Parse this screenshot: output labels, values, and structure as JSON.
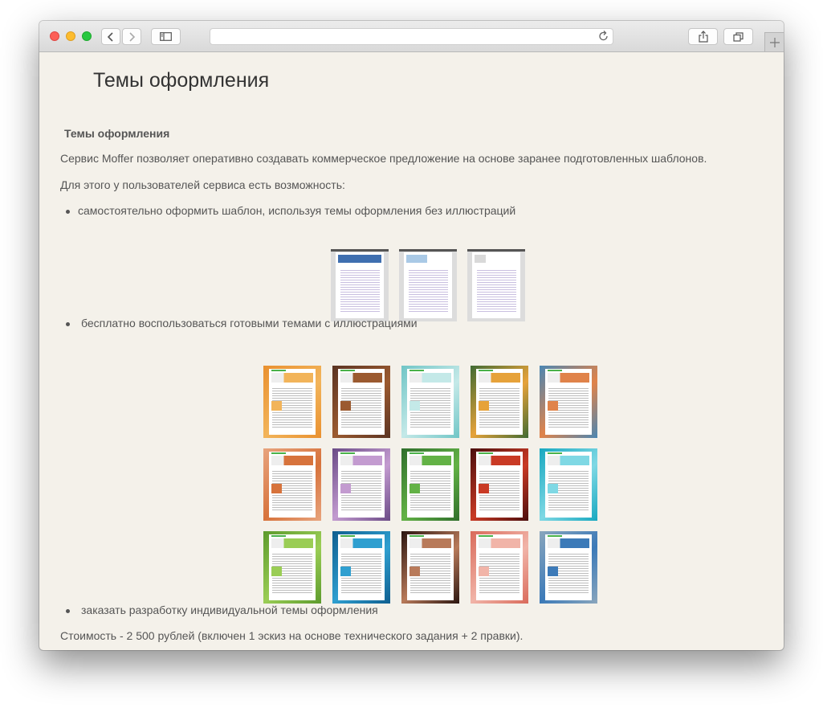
{
  "browser": {
    "url": "",
    "icons": {
      "back": "chevron-left-icon",
      "forward": "chevron-right-icon",
      "sidebar": "sidebar-icon",
      "reload": "reload-icon",
      "share": "share-icon",
      "tabs": "tabs-icon",
      "new_tab": "plus-icon"
    }
  },
  "page": {
    "title": "Темы оформления",
    "section_title": "Темы оформления",
    "intro": "Сервис Moffer позволяет оперативно создавать коммерческое предложение на основе заранее подготовленных шаблонов.",
    "possibility": "Для этого у пользователей сервиса есть возможность:",
    "bullets": [
      "самостоятельно оформить шаблон, используя темы оформления без иллюстраций",
      "бесплатно воспользоваться готовыми темами с иллюстрациями",
      "заказать разработку индивидуальной темы оформления"
    ],
    "price": "Стоимость - 2 500 рублей (включен 1 эскиз на основе технического задания + 2 правки)."
  },
  "plain_themes": [
    {
      "banner": "#3f6fb0"
    },
    {
      "banner": "#a9c9e6"
    },
    {
      "banner": "#d9d9d9"
    }
  ],
  "illustrated_themes": [
    {
      "bg": "#e9902f",
      "accent": "#f2b45a"
    },
    {
      "bg": "#5a3322",
      "accent": "#9b5a30"
    },
    {
      "bg": "#6fc5c6",
      "accent": "#c4e9e8"
    },
    {
      "bg": "#3f6a33",
      "accent": "#e6a23a"
    },
    {
      "bg": "#4a86b3",
      "accent": "#e0834a"
    },
    {
      "bg": "#e8a47e",
      "accent": "#d7733c"
    },
    {
      "bg": "#6a4a86",
      "accent": "#c39bd0"
    },
    {
      "bg": "#2f6e2c",
      "accent": "#63b246"
    },
    {
      "bg": "#4a0d0d",
      "accent": "#c93a25"
    },
    {
      "bg": "#17a8c0",
      "accent": "#7fd8e4"
    },
    {
      "bg": "#5c9a2c",
      "accent": "#9acd55"
    },
    {
      "bg": "#0f5e8f",
      "accent": "#2f9fd0"
    },
    {
      "bg": "#2a1510",
      "accent": "#b87a5a"
    },
    {
      "bg": "#d96a5a",
      "accent": "#f1b4a8"
    },
    {
      "bg": "#8aa6bd",
      "accent": "#3c7ab8"
    }
  ]
}
